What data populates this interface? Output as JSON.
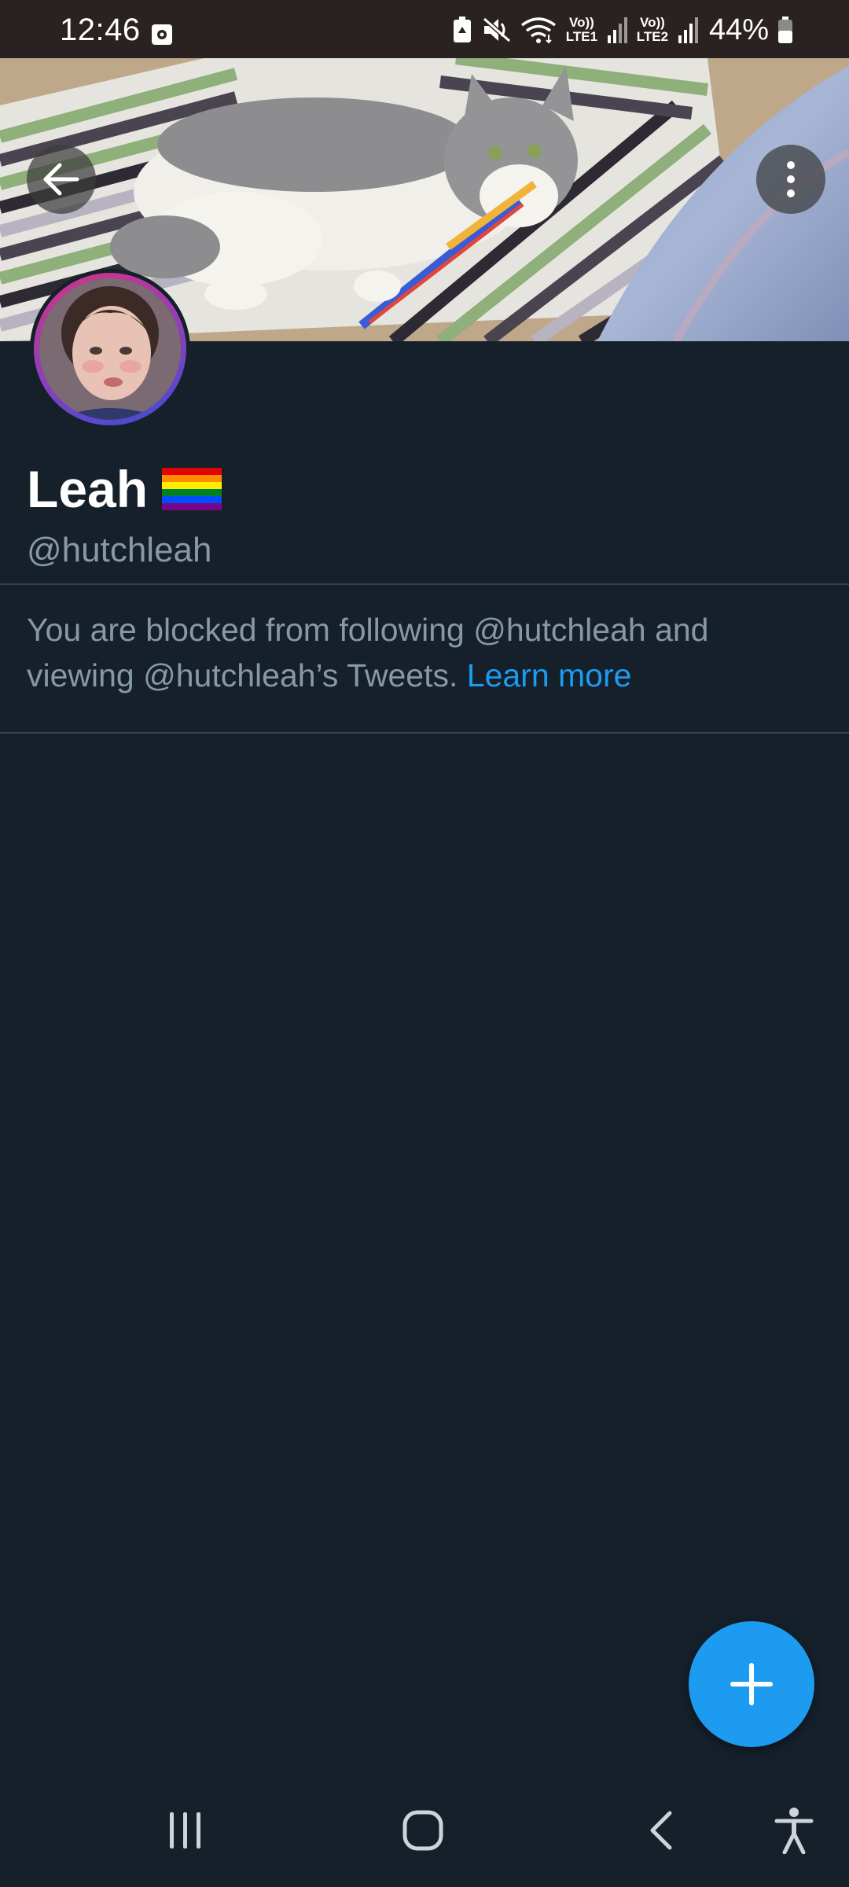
{
  "status_bar": {
    "time": "12:46",
    "lte1": "Vo)) LTE1",
    "lte2": "Vo)) LTE2",
    "battery": "44%"
  },
  "header": {
    "back_icon": "arrow-left-icon",
    "more_icon": "more-vertical-icon"
  },
  "profile": {
    "name": "Leah",
    "name_emoji": "rainbow-flag",
    "handle": "@hutchleah",
    "blocked_message": "You are blocked from following @hutchleah and viewing @hutchleah’s Tweets.",
    "learn_more": "Learn more"
  },
  "fab": {
    "icon": "plus-icon"
  },
  "nav": {
    "recents_icon": "recents-icon",
    "home_icon": "home-icon",
    "back_icon": "back-chevron-icon",
    "accessibility_icon": "accessibility-icon"
  },
  "colors": {
    "background": "#15202b",
    "accent": "#1d9bf0",
    "secondary_text": "#8899a6",
    "divider": "#38444d"
  }
}
